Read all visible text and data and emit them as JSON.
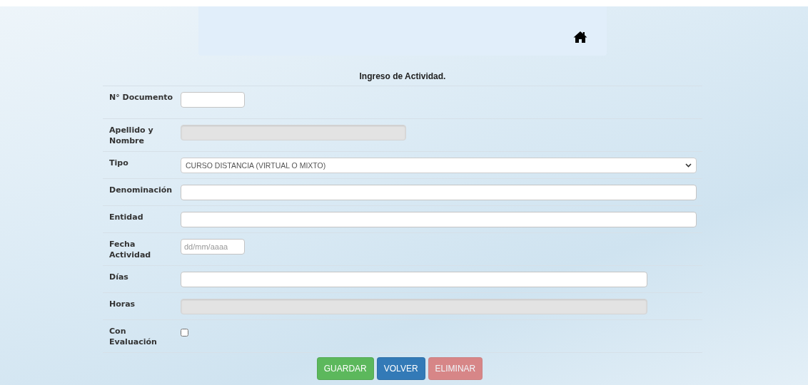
{
  "form": {
    "title": "Ingreso de Actividad.",
    "rows": [
      {
        "label": "N° Documento",
        "kind": "short",
        "disabled": false
      },
      {
        "label": "Apellido y Nombre",
        "kind": "half",
        "disabled": true
      },
      {
        "label": "Tipo",
        "kind": "select",
        "value": "CURSO DISTANCIA (VIRTUAL O MIXTO)"
      },
      {
        "label": "Denominación",
        "kind": "full",
        "disabled": false
      },
      {
        "label": "Entidad",
        "kind": "full",
        "disabled": false
      },
      {
        "label": "Fecha Actividad",
        "kind": "date",
        "placeholder": "dd/mm/aaaa"
      },
      {
        "label": "Días",
        "kind": "wide",
        "disabled": false
      },
      {
        "label": "Horas",
        "kind": "wide",
        "disabled": true
      },
      {
        "label": "Con Evaluación",
        "kind": "checkbox",
        "checked": false
      }
    ]
  },
  "buttons": [
    {
      "label": "GUARDAR",
      "kind": "success",
      "disabled": false
    },
    {
      "label": "VOLVER",
      "kind": "primary",
      "disabled": false
    },
    {
      "label": "ELIMINAR",
      "kind": "danger",
      "disabled": true
    }
  ]
}
